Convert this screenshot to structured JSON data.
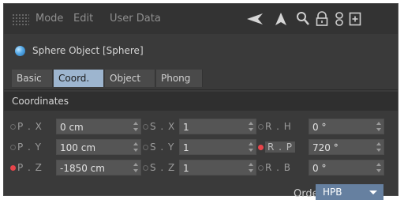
{
  "menu": {
    "items": [
      "Mode",
      "Edit",
      "User Data"
    ]
  },
  "toolbar": {
    "icons": [
      "back-arrow-icon",
      "select-cursor-icon",
      "search-icon",
      "lock-icon",
      "link-icon",
      "add-panel-icon"
    ]
  },
  "object": {
    "title": "Sphere Object [Sphere]",
    "icon": "sphere-icon"
  },
  "tabs": [
    {
      "label": "Basic",
      "active": false
    },
    {
      "label": "Coord.",
      "active": true
    },
    {
      "label": "Object",
      "active": false
    },
    {
      "label": "Phong",
      "active": false
    }
  ],
  "section": {
    "title": "Coordinates"
  },
  "params": {
    "px": {
      "label": "P . X",
      "value": "0 cm",
      "keyframed": false
    },
    "py": {
      "label": "P . Y",
      "value": "100 cm",
      "keyframed": false
    },
    "pz": {
      "label": "P . Z",
      "value": "-1850 cm",
      "keyframed": true
    },
    "sx": {
      "label": "S . X",
      "value": "1",
      "keyframed": false
    },
    "sy": {
      "label": "S . Y",
      "value": "1",
      "keyframed": false
    },
    "sz": {
      "label": "S . Z",
      "value": "1",
      "keyframed": false
    },
    "rh": {
      "label": "R . H",
      "value": "0 °",
      "keyframed": false
    },
    "rp": {
      "label": "R . P",
      "value": "720 °",
      "keyframed": true
    },
    "rb": {
      "label": "R . B",
      "value": "0 °",
      "keyframed": false
    }
  },
  "order": {
    "label": "Order",
    "value": "HPB"
  },
  "colors": {
    "active_tab": "#9db5cf",
    "keyframe": "#e8444a",
    "dropdown": "#6680a0"
  }
}
